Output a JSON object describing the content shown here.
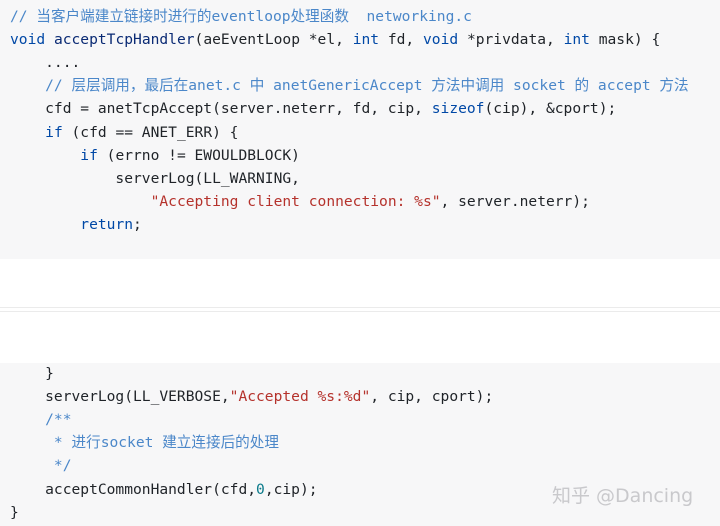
{
  "top_block": [
    {
      "name": "line-comment-header",
      "tokens": [
        {
          "t": "c",
          "v": "// 当客户端建立链接时进行的eventloop处理函数  networking.c"
        }
      ]
    },
    {
      "name": "line-function-signature",
      "tokens": [
        {
          "t": "k",
          "v": "void"
        },
        {
          "t": "y",
          "v": " "
        },
        {
          "t": "f",
          "v": "acceptTcpHandler"
        },
        {
          "t": "y",
          "v": "(aeEventLoop *el, "
        },
        {
          "t": "k",
          "v": "int"
        },
        {
          "t": "y",
          "v": " fd, "
        },
        {
          "t": "k",
          "v": "void"
        },
        {
          "t": "y",
          "v": " *privdata, "
        },
        {
          "t": "k",
          "v": "int"
        },
        {
          "t": "y",
          "v": " mask) {"
        }
      ]
    },
    {
      "name": "line-ellipsis",
      "tokens": [
        {
          "t": "y",
          "v": "    ...."
        }
      ]
    },
    {
      "name": "line-comment-call-chain",
      "tokens": [
        {
          "t": "c",
          "v": "    // 层层调用，最后在anet.c 中 anetGenericAccept 方法中调用 socket 的 accept 方法"
        }
      ]
    },
    {
      "name": "line-anet-tcp-accept",
      "tokens": [
        {
          "t": "y",
          "v": "    cfd = anetTcpAccept(server.neterr, fd, cip, "
        },
        {
          "t": "k",
          "v": "sizeof"
        },
        {
          "t": "y",
          "v": "(cip), &cport);"
        }
      ]
    },
    {
      "name": "line-if-anet-err",
      "tokens": [
        {
          "t": "y",
          "v": "    "
        },
        {
          "t": "k",
          "v": "if"
        },
        {
          "t": "y",
          "v": " (cfd == ANET_ERR) {"
        }
      ]
    },
    {
      "name": "line-if-errno",
      "tokens": [
        {
          "t": "y",
          "v": "        "
        },
        {
          "t": "k",
          "v": "if"
        },
        {
          "t": "y",
          "v": " (errno != EWOULDBLOCK)"
        }
      ]
    },
    {
      "name": "line-serverlog-warning",
      "tokens": [
        {
          "t": "y",
          "v": "            serverLog(LL_WARNING,"
        }
      ]
    },
    {
      "name": "line-accepting-string",
      "tokens": [
        {
          "t": "y",
          "v": "                "
        },
        {
          "t": "s",
          "v": "\"Accepting client connection: %s\""
        },
        {
          "t": "y",
          "v": ", server.neterr);"
        }
      ]
    },
    {
      "name": "line-return",
      "tokens": [
        {
          "t": "y",
          "v": "        "
        },
        {
          "t": "k",
          "v": "return"
        },
        {
          "t": "y",
          "v": ";"
        }
      ]
    }
  ],
  "bottom_block": [
    {
      "name": "line-close-brace-inner",
      "tokens": [
        {
          "t": "y",
          "v": "    }"
        }
      ]
    },
    {
      "name": "line-serverlog-verbose",
      "tokens": [
        {
          "t": "y",
          "v": "    serverLog(LL_VERBOSE,"
        },
        {
          "t": "s",
          "v": "\"Accepted %s:%d\""
        },
        {
          "t": "y",
          "v": ", cip, cport);"
        }
      ]
    },
    {
      "name": "line-doc-open",
      "tokens": [
        {
          "t": "c",
          "v": "    /**"
        }
      ]
    },
    {
      "name": "line-doc-text",
      "tokens": [
        {
          "t": "c",
          "v": "     * 进行socket 建立连接后的处理"
        }
      ]
    },
    {
      "name": "line-doc-close",
      "tokens": [
        {
          "t": "c",
          "v": "     */"
        }
      ]
    },
    {
      "name": "line-accept-common-handler",
      "tokens": [
        {
          "t": "y",
          "v": "    acceptCommonHandler(cfd,"
        },
        {
          "t": "n",
          "v": "0"
        },
        {
          "t": "y",
          "v": ",cip);"
        }
      ]
    },
    {
      "name": "line-close-brace-outer",
      "tokens": [
        {
          "t": "y",
          "v": "}"
        }
      ]
    }
  ],
  "watermark": "知乎 @Dancing"
}
